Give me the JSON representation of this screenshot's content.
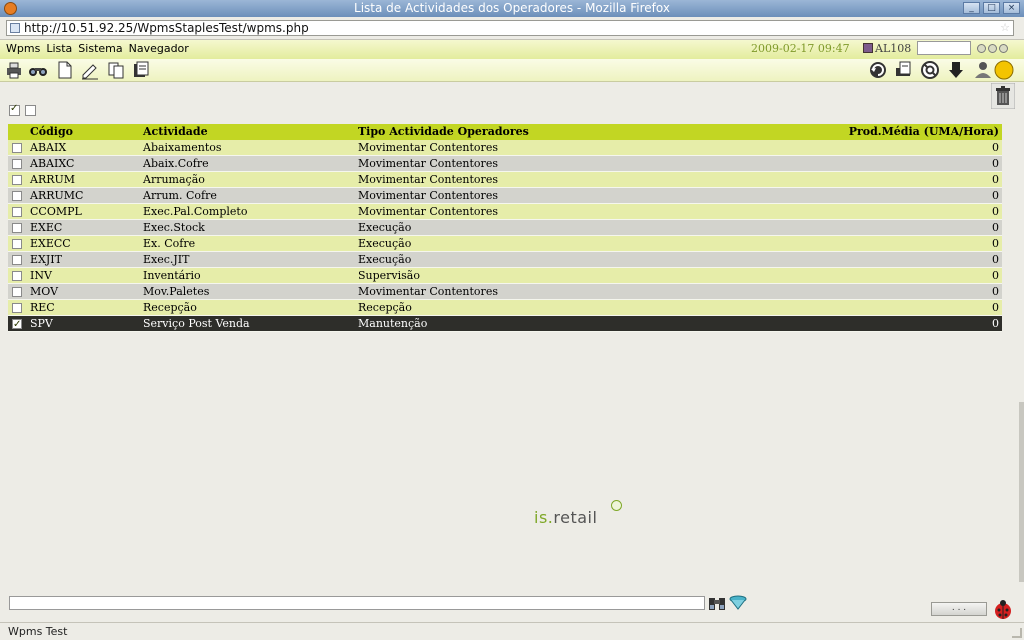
{
  "window": {
    "title": "Lista de Actividades dos Operadores - Mozilla Firefox",
    "buttons": [
      "_",
      "□",
      "×"
    ]
  },
  "browser": {
    "url": "http://10.51.92.25/WpmsStaplesTest/wpms.php"
  },
  "menu": {
    "items": [
      "Wpms",
      "Lista",
      "Sistema",
      "Navegador"
    ]
  },
  "header": {
    "datetime": "2009-02-17  09:47",
    "user": "AL108",
    "search_value": ""
  },
  "toolbar_left": [
    "print-icon",
    "binoculars-icon",
    "new-document-icon",
    "edit-icon",
    "copy-icon",
    "print-list-icon"
  ],
  "toolbar_right": [
    "refresh-icon",
    "print-report-icon",
    "help-lifebuoy-icon",
    "logout-icon",
    "user-settings-icon",
    "status-light-icon"
  ],
  "table": {
    "headers": {
      "codigo": "Código",
      "actividade": "Actividade",
      "tipo": "Tipo Actividade Operadores",
      "prod": "Prod.Média (UMA/Hora)"
    },
    "rows": [
      {
        "codigo": "ABAIX",
        "actividade": "Abaixamentos",
        "tipo": "Movimentar Contentores",
        "prod": "0",
        "checked": false
      },
      {
        "codigo": "ABAIXC",
        "actividade": "Abaix.Cofre",
        "tipo": "Movimentar Contentores",
        "prod": "0",
        "checked": false
      },
      {
        "codigo": "ARRUM",
        "actividade": "Arrumação",
        "tipo": "Movimentar Contentores",
        "prod": "0",
        "checked": false
      },
      {
        "codigo": "ARRUMC",
        "actividade": "Arrum. Cofre",
        "tipo": "Movimentar Contentores",
        "prod": "0",
        "checked": false
      },
      {
        "codigo": "CCOMPL",
        "actividade": "Exec.Pal.Completo",
        "tipo": "Movimentar Contentores",
        "prod": "0",
        "checked": false
      },
      {
        "codigo": "EXEC",
        "actividade": "Exec.Stock",
        "tipo": "Execução",
        "prod": "0",
        "checked": false
      },
      {
        "codigo": "EXECC",
        "actividade": "Ex. Cofre",
        "tipo": "Execução",
        "prod": "0",
        "checked": false
      },
      {
        "codigo": "EXJIT",
        "actividade": "Exec.JIT",
        "tipo": "Execução",
        "prod": "0",
        "checked": false
      },
      {
        "codigo": "INV",
        "actividade": "Inventário",
        "tipo": "Supervisão",
        "prod": "0",
        "checked": false
      },
      {
        "codigo": "MOV",
        "actividade": "Mov.Paletes",
        "tipo": "Movimentar Contentores",
        "prod": "0",
        "checked": false
      },
      {
        "codigo": "REC",
        "actividade": "Recepção",
        "tipo": "Recepção",
        "prod": "0",
        "checked": false
      },
      {
        "codigo": "SPV",
        "actividade": "Serviço Post Venda",
        "tipo": "Manutenção",
        "prod": "0",
        "checked": true
      }
    ]
  },
  "logo": {
    "prefix": "is.",
    "name": "retail"
  },
  "footer": {
    "command_value": "",
    "more_label": ". . .",
    "status_text": "Wpms Test"
  },
  "colors": {
    "header_row": "#c2d623",
    "odd_row": "#e6eda9",
    "even_row": "#d3d3cd",
    "selected_row": "#2e2e2a",
    "accent_text": "#7f9a2a"
  }
}
